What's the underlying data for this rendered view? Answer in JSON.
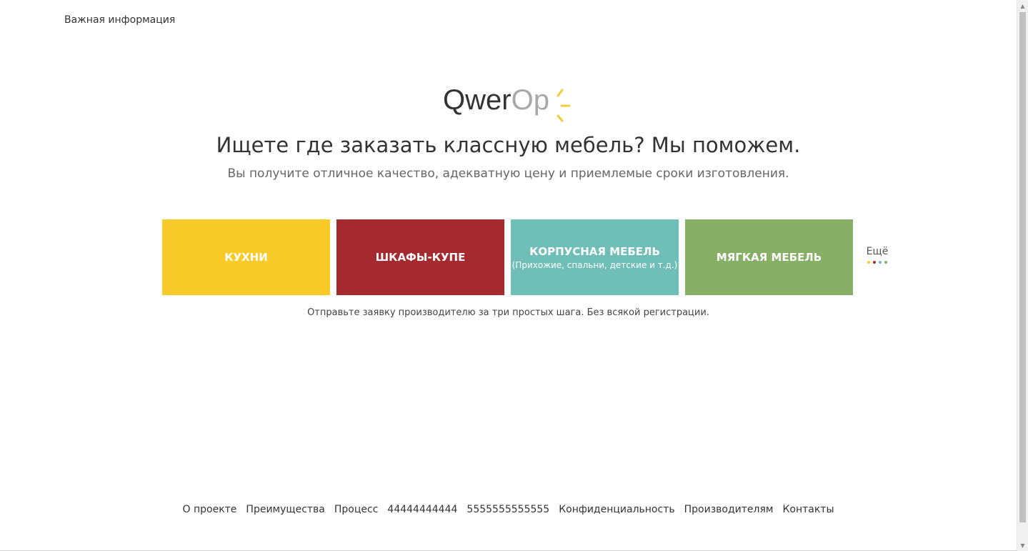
{
  "top_nav": {
    "info_link": "Важная информация"
  },
  "logo": {
    "part1": "Qwer",
    "part2": "Op",
    "accent_color": "#f5cb3a"
  },
  "hero": {
    "headline": "Ищете где заказать классную мебель? Мы поможем.",
    "subline": "Вы получите отличное качество, адекватную цену и приемлемые сроки изготовления."
  },
  "categories": [
    {
      "title": "КУХНИ",
      "subtitle": "",
      "color": "#f8cb28"
    },
    {
      "title": "ШКАФЫ-КУПЕ",
      "subtitle": "",
      "color": "#a52a2f"
    },
    {
      "title": "КОРПУСНАЯ МЕБЕЛЬ",
      "subtitle": "(Прихожие, спальни, детские и т.д.)",
      "color": "#6fbfb8"
    },
    {
      "title": "МЯГКАЯ МЕБЕЛЬ",
      "subtitle": "",
      "color": "#87b066"
    }
  ],
  "more": {
    "label": "Ещё",
    "dot_colors": [
      "#f8cb28",
      "#a52a2f",
      "#6fbfb8",
      "#87b066"
    ]
  },
  "steps_note": "Отправьте заявку производителю за три простых шага. Без всякой регистрации.",
  "footer": {
    "links": [
      "О проекте",
      "Преимущества",
      "Процесс",
      "44444444444",
      "5555555555555",
      "Конфиденциальность",
      "Производителям",
      "Контакты"
    ]
  }
}
